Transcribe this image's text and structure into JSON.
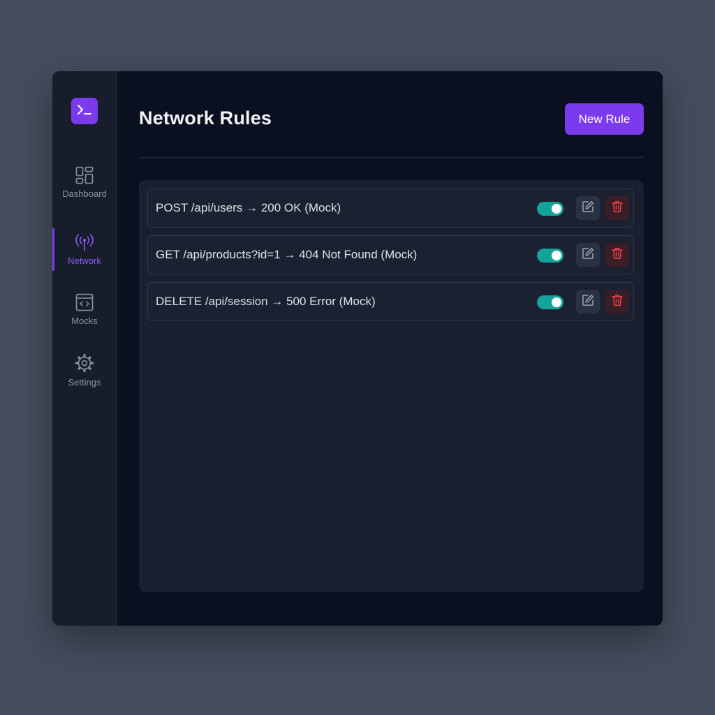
{
  "app": {
    "logo_icon": "terminal-icon",
    "accent_color": "#7c3aed"
  },
  "sidebar": {
    "items": [
      {
        "label": "Dashboard",
        "icon": "dashboard-icon",
        "active": false
      },
      {
        "label": "Network",
        "icon": "antenna-icon",
        "active": true
      },
      {
        "label": "Mocks",
        "icon": "code-window-icon",
        "active": false
      },
      {
        "label": "Settings",
        "icon": "gear-icon",
        "active": false
      }
    ]
  },
  "header": {
    "title": "Network Rules",
    "new_rule_label": "New Rule"
  },
  "rules": [
    {
      "text": "POST /api/users → 200 OK (Mock)",
      "enabled": true
    },
    {
      "text": "GET /api/products?id=1 → 404 Not Found (Mock)",
      "enabled": true
    },
    {
      "text": "DELETE /api/session → 500 Error (Mock)",
      "enabled": true
    }
  ],
  "colors": {
    "toggle_on": "#14a39a",
    "delete": "#ef4444",
    "edit": "#9aa4b5"
  }
}
